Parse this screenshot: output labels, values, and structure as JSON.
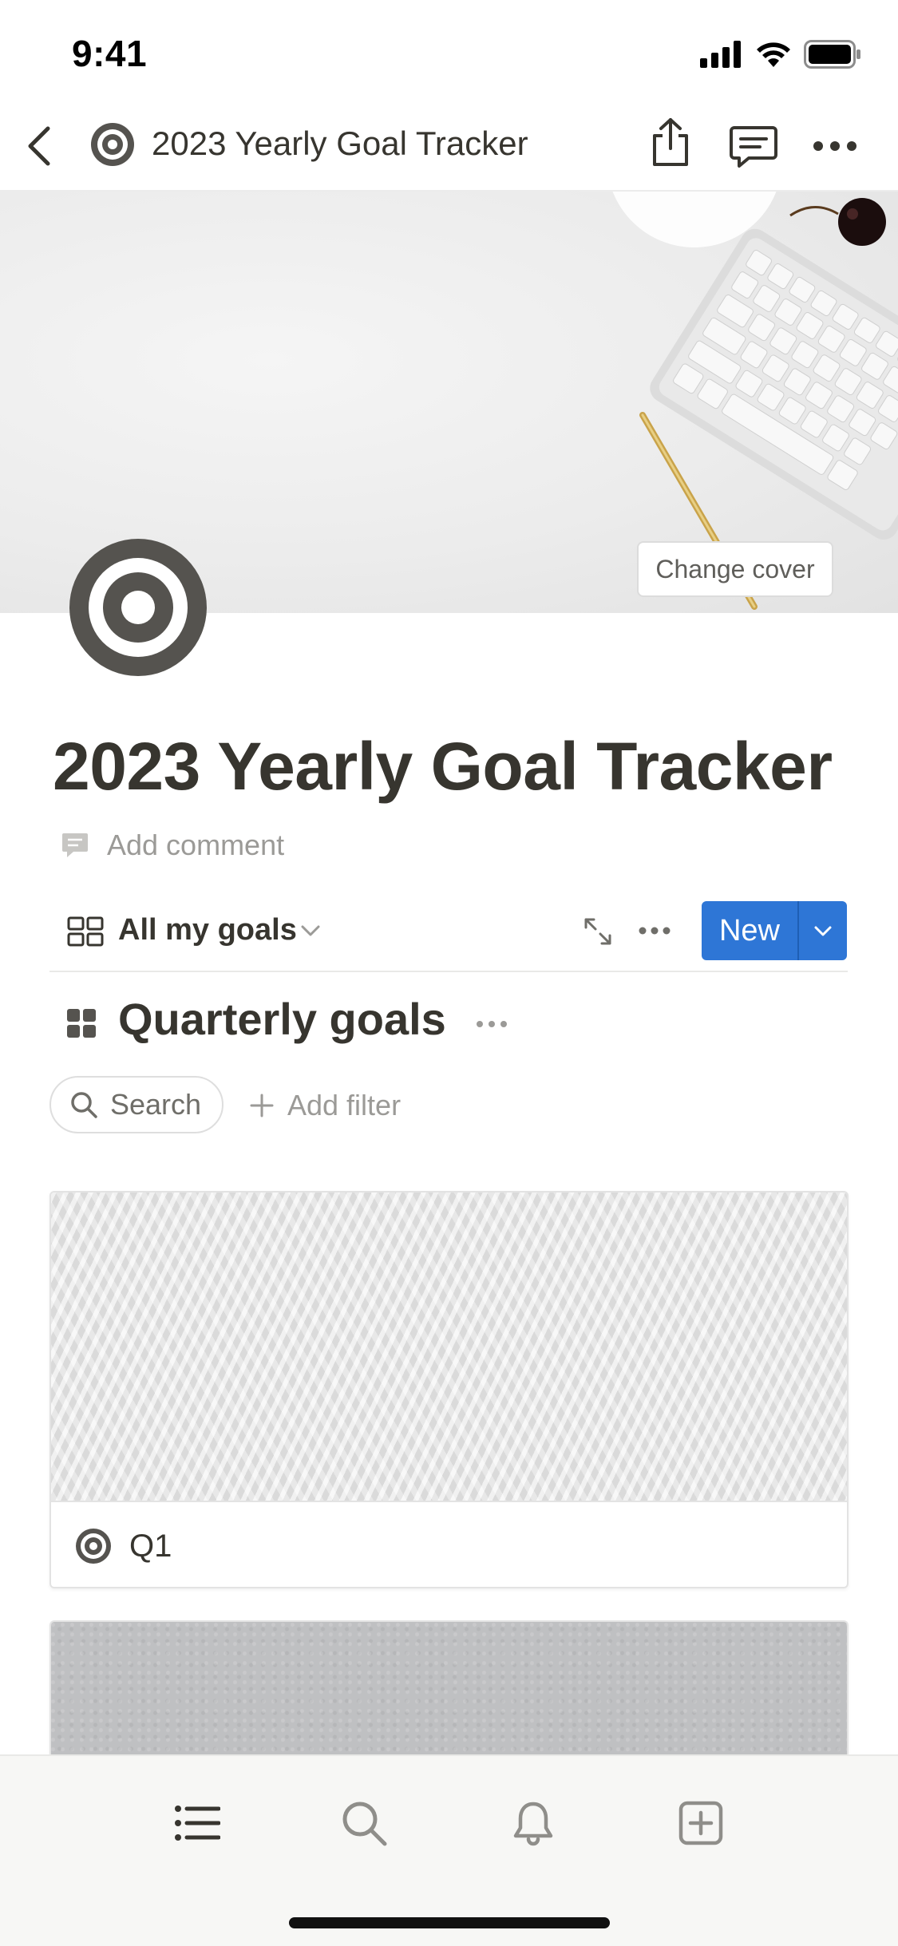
{
  "status_bar": {
    "time": "9:41"
  },
  "nav": {
    "title": "2023 Yearly Goal Tracker"
  },
  "cover": {
    "change_label": "Change cover"
  },
  "page": {
    "title": "2023 Yearly Goal Tracker",
    "add_comment": "Add comment"
  },
  "view": {
    "name": "All my goals",
    "new_label": "New"
  },
  "database": {
    "title": "Quarterly goals",
    "search_label": "Search",
    "add_filter_label": "Add filter"
  },
  "cards": [
    {
      "title": "Q1"
    }
  ],
  "colors": {
    "accent": "#2e76d6",
    "text": "#37352f",
    "muted": "#9b9a97",
    "icon_dark": "#55534f"
  }
}
